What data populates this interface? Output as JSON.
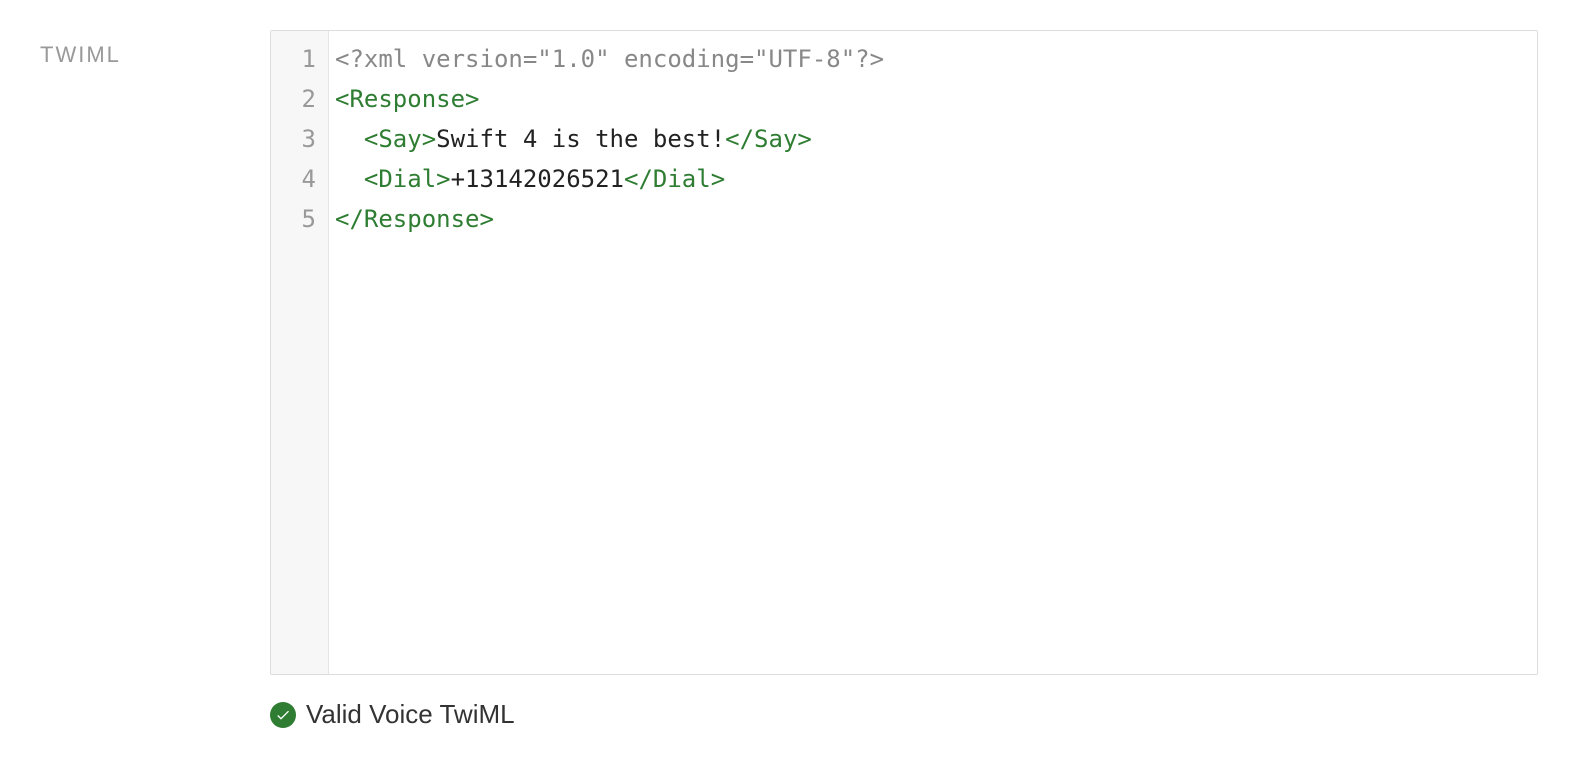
{
  "label": "TWIML",
  "code": {
    "lines": [
      {
        "number": "1",
        "segments": [
          {
            "class": "xml-decl",
            "text": "<?xml version=\"1.0\" encoding=\"UTF-8\"?>"
          }
        ]
      },
      {
        "number": "2",
        "segments": [
          {
            "class": "xml-tag",
            "text": "<Response>"
          }
        ]
      },
      {
        "number": "3",
        "segments": [
          {
            "class": "indent",
            "text": "  "
          },
          {
            "class": "xml-tag",
            "text": "<Say>"
          },
          {
            "class": "xml-text",
            "text": "Swift 4 is the best!"
          },
          {
            "class": "xml-tag",
            "text": "</Say>"
          }
        ]
      },
      {
        "number": "4",
        "segments": [
          {
            "class": "indent",
            "text": "  "
          },
          {
            "class": "xml-tag",
            "text": "<Dial>"
          },
          {
            "class": "xml-text",
            "text": "+13142026521"
          },
          {
            "class": "xml-tag",
            "text": "</Dial>"
          }
        ]
      },
      {
        "number": "5",
        "segments": [
          {
            "class": "xml-tag",
            "text": "</Response>"
          }
        ]
      }
    ]
  },
  "validation": {
    "message": "Valid Voice TwiML"
  }
}
